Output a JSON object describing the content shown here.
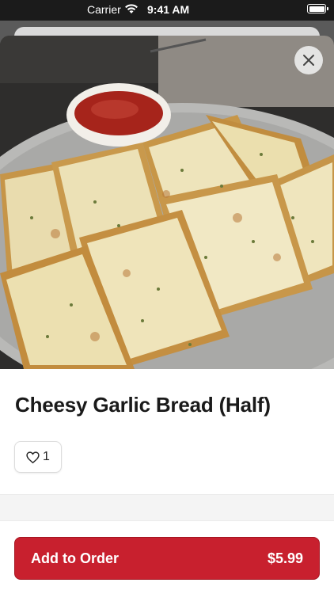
{
  "status_bar": {
    "carrier": "Carrier",
    "time": "9:41 AM"
  },
  "item": {
    "title": "Cheesy Garlic Bread (Half)",
    "like_count": "1",
    "image_icon": "food-photo"
  },
  "actions": {
    "add_to_order_label": "Add to Order",
    "price": "$5.99"
  },
  "colors": {
    "accent": "#c8202e",
    "status_bar": "#1b1b1b"
  },
  "icons": {
    "close": "close-icon",
    "like": "heart-icon",
    "wifi": "wifi-icon",
    "battery": "battery-icon"
  }
}
